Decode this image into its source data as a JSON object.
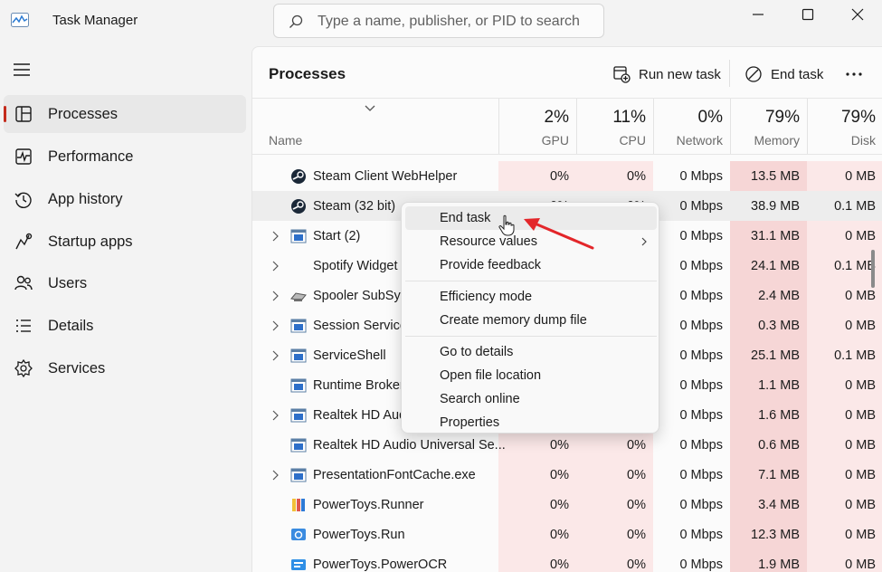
{
  "window": {
    "title": "Task Manager",
    "search_placeholder": "Type a name, publisher, or PID to search"
  },
  "sidebar": {
    "items": [
      {
        "label": "Processes",
        "icon": "processes-icon",
        "active": true
      },
      {
        "label": "Performance",
        "icon": "performance-icon"
      },
      {
        "label": "App history",
        "icon": "app-history-icon"
      },
      {
        "label": "Startup apps",
        "icon": "startup-apps-icon"
      },
      {
        "label": "Users",
        "icon": "users-icon"
      },
      {
        "label": "Details",
        "icon": "details-icon"
      },
      {
        "label": "Services",
        "icon": "services-icon"
      }
    ]
  },
  "header": {
    "page_title": "Processes",
    "run_new_task": "Run new task",
    "end_task": "End task",
    "more": "..."
  },
  "columns": {
    "name": "Name",
    "gpu": {
      "pct": "2%",
      "label": "GPU"
    },
    "cpu": {
      "pct": "11%",
      "label": "CPU"
    },
    "network": {
      "pct": "0%",
      "label": "Network"
    },
    "memory": {
      "pct": "79%",
      "label": "Memory"
    },
    "disk": {
      "pct": "79%",
      "label": "Disk"
    }
  },
  "processes": [
    {
      "name": "Steam Client WebHelper",
      "expand": false,
      "icon": "steam-icon",
      "gpu": "0%",
      "cpu": "0%",
      "network": "0 Mbps",
      "memory": "13.5 MB",
      "disk": "0 MB"
    },
    {
      "name": "Steam (32 bit)",
      "expand": false,
      "icon": "steam-icon",
      "gpu": "0%",
      "cpu": "0%",
      "network": "0 Mbps",
      "memory": "38.9 MB",
      "disk": "0.1 MB"
    },
    {
      "name": "Start (2)",
      "expand": true,
      "icon": "window-icon",
      "gpu": "",
      "cpu": "",
      "network": "0 Mbps",
      "memory": "31.1 MB",
      "disk": "0 MB"
    },
    {
      "name": "Spotify Widget",
      "expand": true,
      "icon": "",
      "gpu": "",
      "cpu": "",
      "network": "0 Mbps",
      "memory": "24.1 MB",
      "disk": "0.1 MB"
    },
    {
      "name": "Spooler SubSys",
      "expand": true,
      "icon": "printer-icon",
      "gpu": "",
      "cpu": "",
      "network": "0 Mbps",
      "memory": "2.4 MB",
      "disk": "0 MB"
    },
    {
      "name": "Session  Service",
      "expand": true,
      "icon": "window-icon",
      "gpu": "",
      "cpu": "",
      "network": "0 Mbps",
      "memory": "0.3 MB",
      "disk": "0 MB"
    },
    {
      "name": "ServiceShell",
      "expand": true,
      "icon": "window-icon",
      "gpu": "",
      "cpu": "",
      "network": "0 Mbps",
      "memory": "25.1 MB",
      "disk": "0.1 MB"
    },
    {
      "name": "Runtime Broker",
      "expand": false,
      "icon": "window-icon",
      "gpu": "",
      "cpu": "",
      "network": "0 Mbps",
      "memory": "1.1 MB",
      "disk": "0 MB"
    },
    {
      "name": "Realtek HD Aud",
      "expand": true,
      "icon": "window-icon",
      "gpu": "",
      "cpu": "",
      "network": "0 Mbps",
      "memory": "1.6 MB",
      "disk": "0 MB"
    },
    {
      "name": "Realtek HD Audio Universal Se...",
      "expand": false,
      "icon": "window-icon",
      "gpu": "0%",
      "cpu": "0%",
      "network": "0 Mbps",
      "memory": "0.6 MB",
      "disk": "0 MB"
    },
    {
      "name": "PresentationFontCache.exe",
      "expand": true,
      "icon": "window-icon",
      "gpu": "0%",
      "cpu": "0%",
      "network": "0 Mbps",
      "memory": "7.1 MB",
      "disk": "0 MB"
    },
    {
      "name": "PowerToys.Runner",
      "expand": false,
      "icon": "powertoys-icon",
      "gpu": "0%",
      "cpu": "0%",
      "network": "0 Mbps",
      "memory": "3.4 MB",
      "disk": "0 MB"
    },
    {
      "name": "PowerToys.Run",
      "expand": false,
      "icon": "powertoys-run-icon",
      "gpu": "0%",
      "cpu": "0%",
      "network": "0 Mbps",
      "memory": "12.3 MB",
      "disk": "0 MB"
    },
    {
      "name": "PowerToys.PowerOCR",
      "expand": false,
      "icon": "powertoys-ocr-icon",
      "gpu": "0%",
      "cpu": "0%",
      "network": "0 Mbps",
      "memory": "1.9 MB",
      "disk": "0 MB"
    }
  ],
  "context_menu": {
    "groups": [
      [
        "End task",
        "Resource values",
        "Provide feedback"
      ],
      [
        "Efficiency mode",
        "Create memory dump file"
      ],
      [
        "Go to details",
        "Open file location",
        "Search online",
        "Properties"
      ]
    ],
    "highlighted": "End task",
    "submenu_item": "Resource values"
  },
  "colors": {
    "accent": "#c42b1c",
    "heat_light": "#fbe8e8",
    "heat_medium": "#f6d6d6",
    "annotation_arrow": "#e3262a"
  }
}
